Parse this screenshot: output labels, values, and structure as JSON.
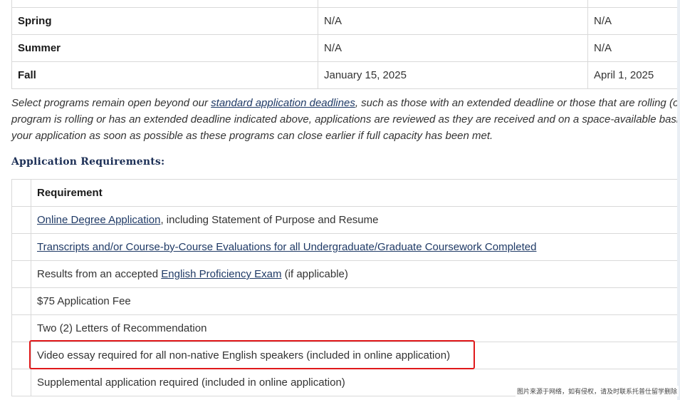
{
  "deadlines": {
    "rows": [
      {
        "term": "Spring",
        "date1": "N/A",
        "date2": "N/A"
      },
      {
        "term": "Summer",
        "date1": "N/A",
        "date2": "N/A"
      },
      {
        "term": "Fall",
        "date1": "January 15, 2025",
        "date2": "April 1, 2025"
      }
    ]
  },
  "note": {
    "line1_before": "Select programs remain open beyond our ",
    "line1_link": "standard application deadlines",
    "line1_after": ", such as those with an extended deadline or those that are rolling (op",
    "line2": "program is rolling or has an extended deadline indicated above, applications are reviewed as they are received and on a space-available basis. I",
    "line3": "your application as soon as possible as these programs can close earlier if full capacity has been met."
  },
  "requirements": {
    "heading": "Application Requirements:",
    "column_header": "Requirement",
    "items": [
      {
        "before": "",
        "link": "Online Degree Application",
        "after": ", including Statement of Purpose and Resume"
      },
      {
        "before": "",
        "link": "Transcripts and/or Course-by-Course Evaluations for all Undergraduate/Graduate Coursework Completed",
        "after": ""
      },
      {
        "before": "Results from an accepted ",
        "link": "English Proficiency Exam",
        "after": " (if applicable)"
      },
      {
        "before": "$75 Application Fee",
        "link": "",
        "after": ""
      },
      {
        "before": "Two (2) Letters of Recommendation",
        "link": "",
        "after": ""
      },
      {
        "before": "Video essay required for all non-native English speakers (included in online application)",
        "link": "",
        "after": ""
      },
      {
        "before": "Supplemental application required (included in online application)",
        "link": "",
        "after": ""
      }
    ]
  },
  "watermark": "图片来源于网络，如有侵权，请及时联系托普仕留学删除",
  "colors": {
    "link": "#1f3a66",
    "heading": "#1c2f56",
    "highlight": "#e0191b",
    "border": "#d9d9d9"
  }
}
